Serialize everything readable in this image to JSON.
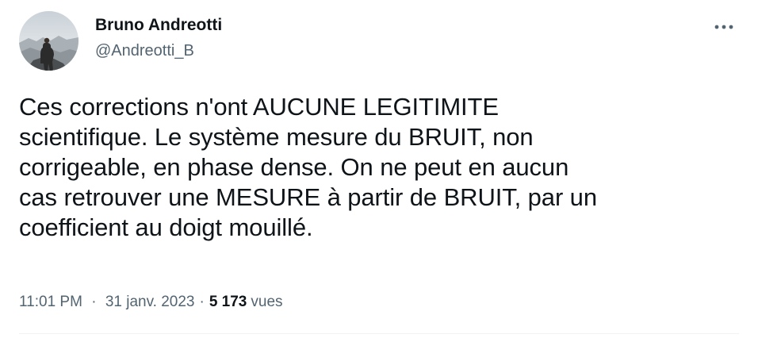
{
  "tweet": {
    "author": {
      "name": "Bruno Andreotti",
      "handle": "@Andreotti_B"
    },
    "more_icon": "more-horizontal-icon",
    "text": "Ces corrections n'ont AUCUNE LEGITIMITE\nscientifique. Le système mesure du BRUIT, non\ncorrigeable, en phase dense. On ne peut en aucun\ncas retrouver une MESURE à partir de BRUIT, par un\ncoefficient au doigt mouillé.",
    "time": "11:01 PM",
    "date": "31 janv. 2023",
    "separator": "·",
    "views_count": "5 173",
    "views_label": "vues"
  },
  "colors": {
    "text_primary": "#0f1419",
    "text_secondary": "#536471",
    "divider": "#eff3f4"
  }
}
